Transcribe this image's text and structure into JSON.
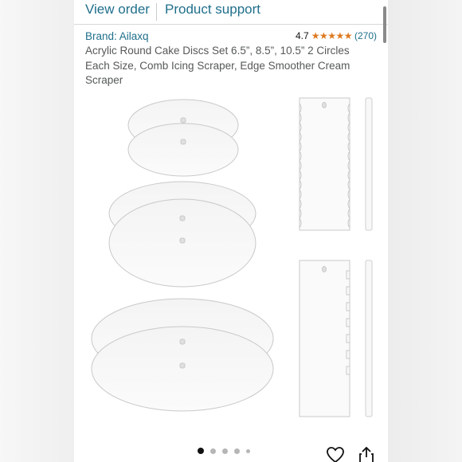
{
  "topbar": {
    "view_order": "View order",
    "product_support": "Product support"
  },
  "product": {
    "brand": "Brand: Ailaxq",
    "rating": "4.7",
    "stars": "★★★★★",
    "review_count": "(270)",
    "title": "Acrylic Round Cake Discs Set 6.5”, 8.5”, 10.5” 2 Circles Each Size, Comb Icing Scraper, Edge Smoother Cream Scraper"
  },
  "carousel": {
    "total": 5,
    "active": 1
  },
  "icons": {
    "heart": "heart-icon",
    "share": "share-icon"
  }
}
